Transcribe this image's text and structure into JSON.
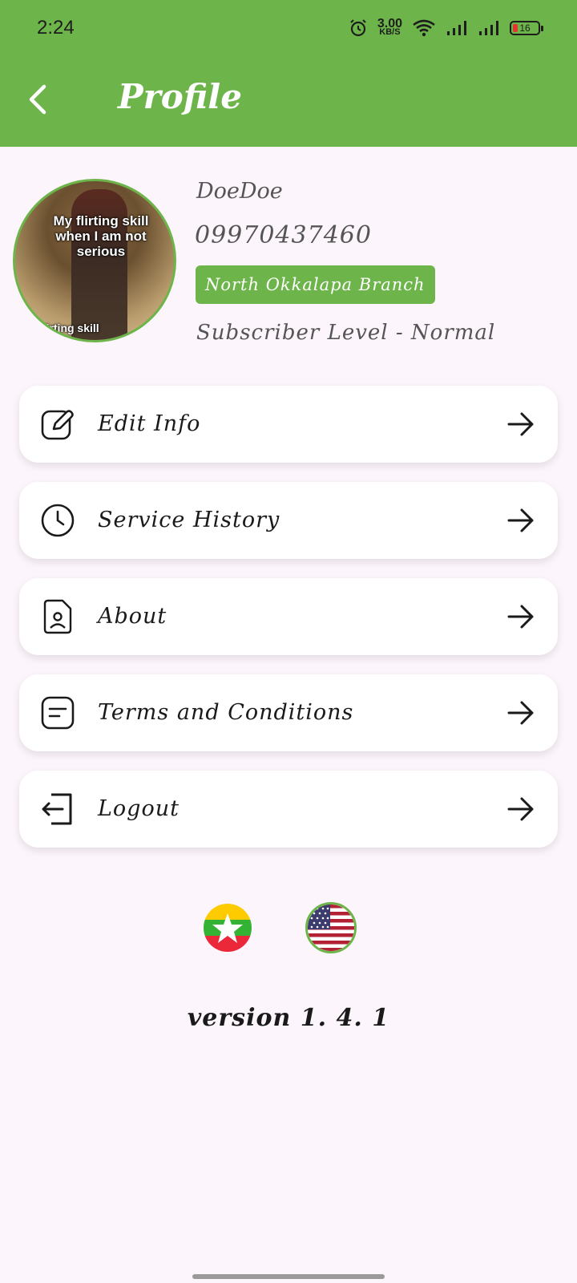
{
  "status_bar": {
    "time": "2:24",
    "speed_value": "3.00",
    "speed_unit": "KB/S",
    "battery": "16",
    "icons": [
      "alarm-icon",
      "wifi-icon",
      "signal-icon",
      "signal-icon",
      "battery-icon"
    ]
  },
  "header": {
    "title": "Profile",
    "back_icon": "back-chevron-icon",
    "color": "#6db54a"
  },
  "profile": {
    "avatar_caption_top": "My flirting skill when I am not serious",
    "avatar_caption_bottom": "flirting skill",
    "name": "DoeDoe",
    "phone": "09970437460",
    "branch": "North Okkalapa Branch",
    "subscriber_level": "Subscriber Level - Normal"
  },
  "menu": {
    "items": [
      {
        "label": "Edit Info",
        "icon": "edit-icon"
      },
      {
        "label": "Service History",
        "icon": "clock-icon"
      },
      {
        "label": "About",
        "icon": "document-user-icon"
      },
      {
        "label": "Terms and Conditions",
        "icon": "note-icon"
      },
      {
        "label": "Logout",
        "icon": "logout-icon"
      }
    ],
    "arrow_icon": "arrow-right-icon"
  },
  "languages": [
    {
      "name": "myanmar-flag-icon",
      "selected": false
    },
    {
      "name": "us-flag-icon",
      "selected": true
    }
  ],
  "footer": {
    "version": "version 1. 4. 1"
  }
}
